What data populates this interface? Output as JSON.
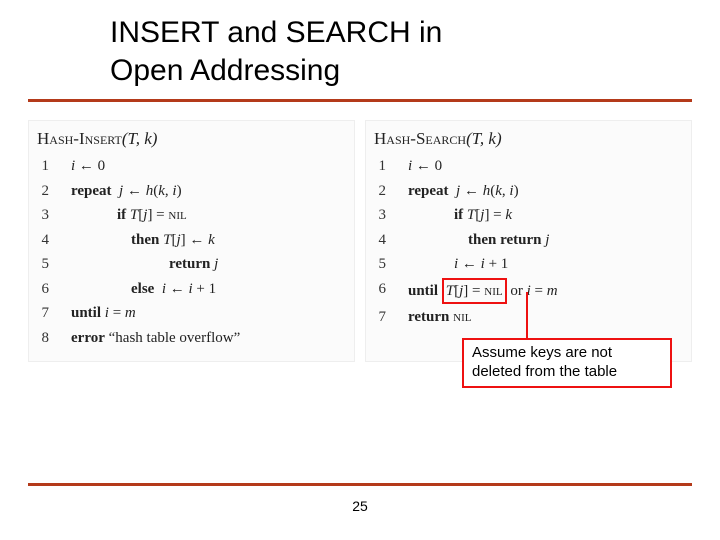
{
  "title_line1": "INSERT and SEARCH in",
  "title_line2": "Open Addressing",
  "insert": {
    "name": "Hash-Insert",
    "args": "(T, k)",
    "lines": [
      "i ← 0",
      "repeat  j ← h(k, i)",
      "if T[j] = NIL",
      "then T[j] ← k",
      "return j",
      "else  i ← i + 1",
      "until i = m",
      "error “hash table overflow”"
    ]
  },
  "search": {
    "name": "Hash-Search",
    "args": "(T, k)",
    "lines": [
      "i ← 0",
      "repeat  j ← h(k, i)",
      "if T[j] = k",
      "then return j",
      "i ← i + 1",
      "until T[j] = NIL or i = m",
      "return NIL"
    ],
    "boxed_fragment": "T[j] = NIL"
  },
  "note_line1": "Assume keys are not",
  "note_line2": "deleted from the table",
  "page_number": "25"
}
